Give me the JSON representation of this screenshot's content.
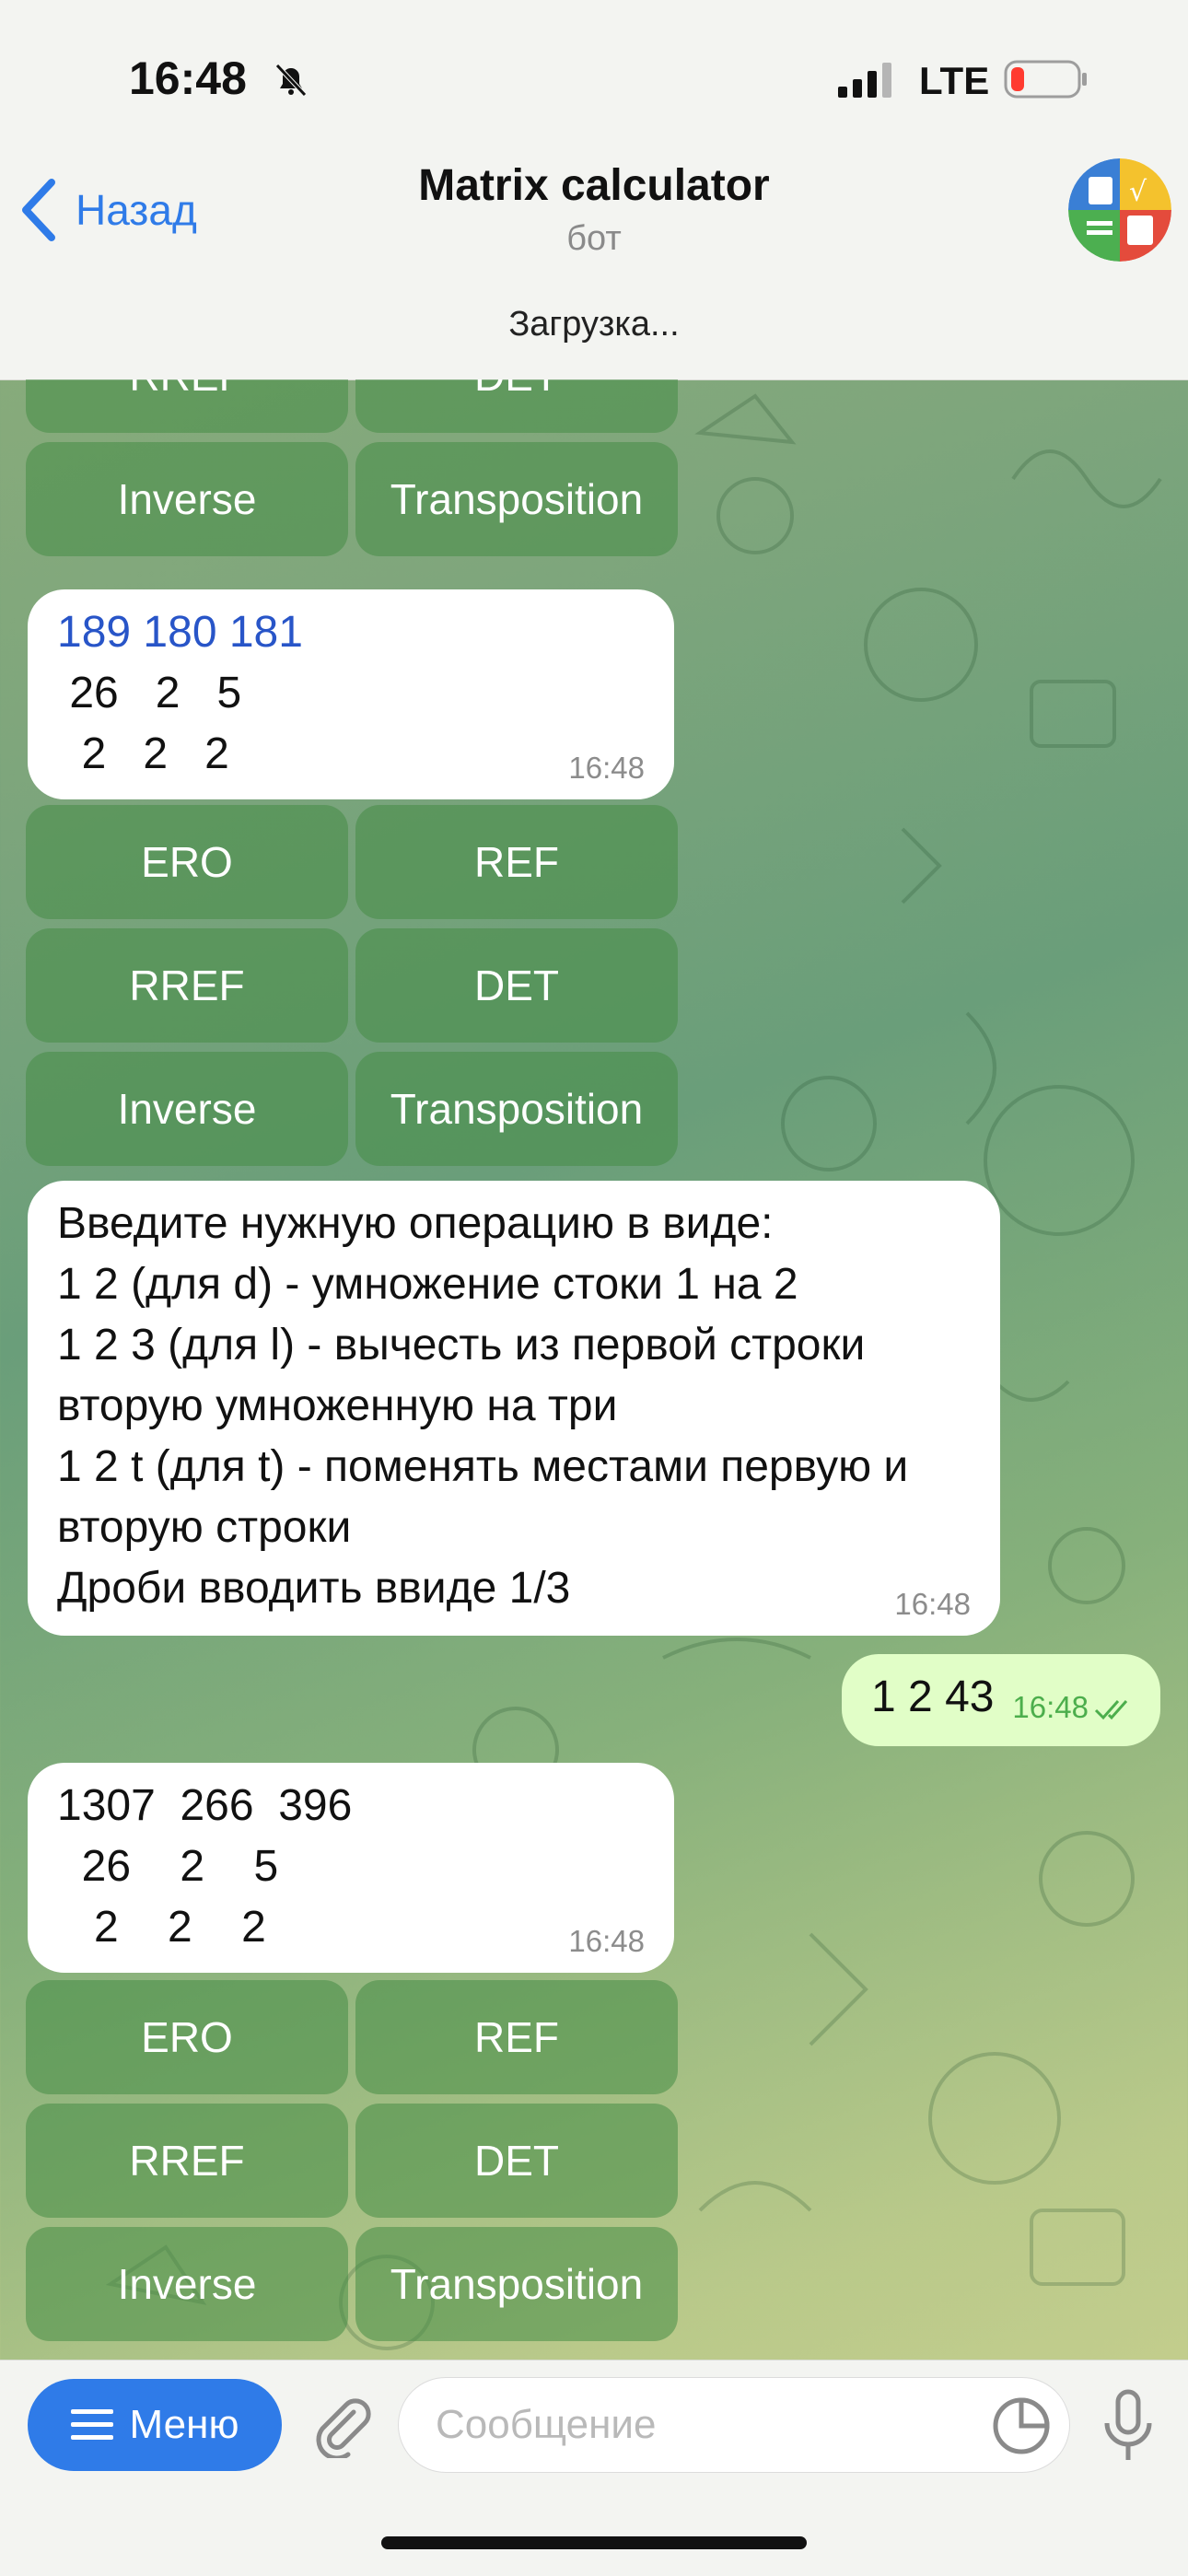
{
  "status_bar": {
    "time": "16:48",
    "network": "LTE",
    "battery_color": "#ff3b30"
  },
  "header": {
    "back_label": "Назад",
    "title": "Matrix calculator",
    "subtitle": "бот",
    "accent": "#2f7be8"
  },
  "loading_text": "Загрузка...",
  "keyboard_top_partial": [
    "RREF",
    "DET"
  ],
  "keyboard_labels": [
    [
      "ERO",
      "REF"
    ],
    [
      "RREF",
      "DET"
    ],
    [
      "Inverse",
      "Transposition"
    ]
  ],
  "messages": [
    {
      "lines": [
        "189 180 181",
        " 26   2   5",
        "  2   2   2"
      ],
      "time": "16:48"
    },
    {
      "lines": [
        "Введите нужную операцию в виде:",
        "1 2 (для d) - умножение стоки 1 на 2",
        "1 2 3 (для l) - вычесть из первой строки",
        "вторую умноженную на три",
        "1 2 t (для t) - поменять местами первую и",
        "вторую строки",
        "Дроби вводить ввиде 1/3"
      ],
      "time": "16:48"
    },
    {
      "text": "1 2 43",
      "time": "16:48"
    },
    {
      "lines": [
        "1307  266  396",
        "  26    2    5",
        "   2    2    2"
      ],
      "time": "16:48"
    }
  ],
  "input": {
    "menu_label": "Меню",
    "placeholder": "Сообщение"
  }
}
